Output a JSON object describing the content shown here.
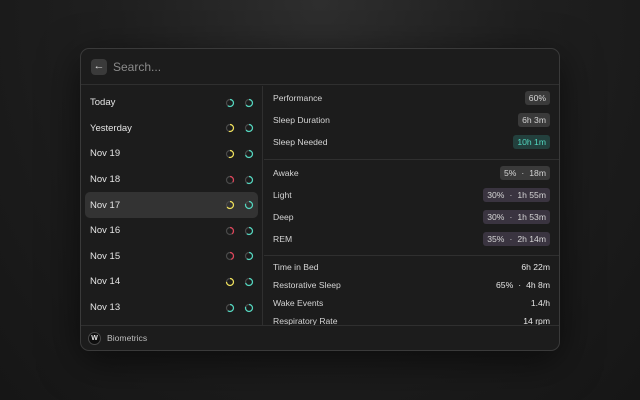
{
  "search": {
    "placeholder": "Search...",
    "value": ""
  },
  "colors": {
    "teal": "#52d8c0",
    "yellow": "#f0e15a",
    "red": "#e0445a",
    "track": "#4a4a4a"
  },
  "days": [
    {
      "label": "Today",
      "selected": false,
      "rings": [
        {
          "color": "teal",
          "fraction": 0.6
        },
        {
          "color": "teal",
          "fraction": 0.65
        }
      ]
    },
    {
      "label": "Yesterday",
      "selected": false,
      "rings": [
        {
          "color": "yellow",
          "fraction": 0.55
        },
        {
          "color": "teal",
          "fraction": 0.65
        }
      ]
    },
    {
      "label": "Nov 19",
      "selected": false,
      "rings": [
        {
          "color": "yellow",
          "fraction": 0.55
        },
        {
          "color": "teal",
          "fraction": 0.7
        }
      ]
    },
    {
      "label": "Nov 18",
      "selected": false,
      "rings": [
        {
          "color": "red",
          "fraction": 0.35
        },
        {
          "color": "teal",
          "fraction": 0.6
        }
      ]
    },
    {
      "label": "Nov 17",
      "selected": true,
      "rings": [
        {
          "color": "yellow",
          "fraction": 0.65
        },
        {
          "color": "teal",
          "fraction": 0.8
        }
      ]
    },
    {
      "label": "Nov 16",
      "selected": false,
      "rings": [
        {
          "color": "red",
          "fraction": 0.4
        },
        {
          "color": "teal",
          "fraction": 0.6
        }
      ]
    },
    {
      "label": "Nov 15",
      "selected": false,
      "rings": [
        {
          "color": "red",
          "fraction": 0.45
        },
        {
          "color": "teal",
          "fraction": 0.6
        }
      ]
    },
    {
      "label": "Nov 14",
      "selected": false,
      "rings": [
        {
          "color": "yellow",
          "fraction": 0.75
        },
        {
          "color": "teal",
          "fraction": 0.7
        }
      ]
    },
    {
      "label": "Nov 13",
      "selected": false,
      "rings": [
        {
          "color": "teal",
          "fraction": 0.6
        },
        {
          "color": "teal",
          "fraction": 0.8
        }
      ]
    }
  ],
  "detail": {
    "performance": {
      "label": "Performance",
      "value": "60%"
    },
    "sleep_duration": {
      "label": "Sleep Duration",
      "value": "6h 3m"
    },
    "sleep_needed": {
      "label": "Sleep Needed",
      "value": "10h 1m"
    },
    "awake": {
      "label": "Awake",
      "pct": "5%",
      "time": "18m"
    },
    "light": {
      "label": "Light",
      "pct": "30%",
      "time": "1h 55m"
    },
    "deep": {
      "label": "Deep",
      "pct": "30%",
      "time": "1h 53m"
    },
    "rem": {
      "label": "REM",
      "pct": "35%",
      "time": "2h 14m"
    },
    "time_in_bed": {
      "label": "Time in Bed",
      "value": "6h 22m"
    },
    "restorative_sleep": {
      "label": "Restorative Sleep",
      "pct": "65%",
      "time": "4h 8m"
    },
    "wake_events": {
      "label": "Wake Events",
      "value": "1.4/h"
    },
    "respiratory_rate": {
      "label": "Respiratory Rate",
      "value": "14 rpm"
    },
    "separator": "·"
  },
  "footer": {
    "logo_letter": "W",
    "label": "Biometrics"
  }
}
